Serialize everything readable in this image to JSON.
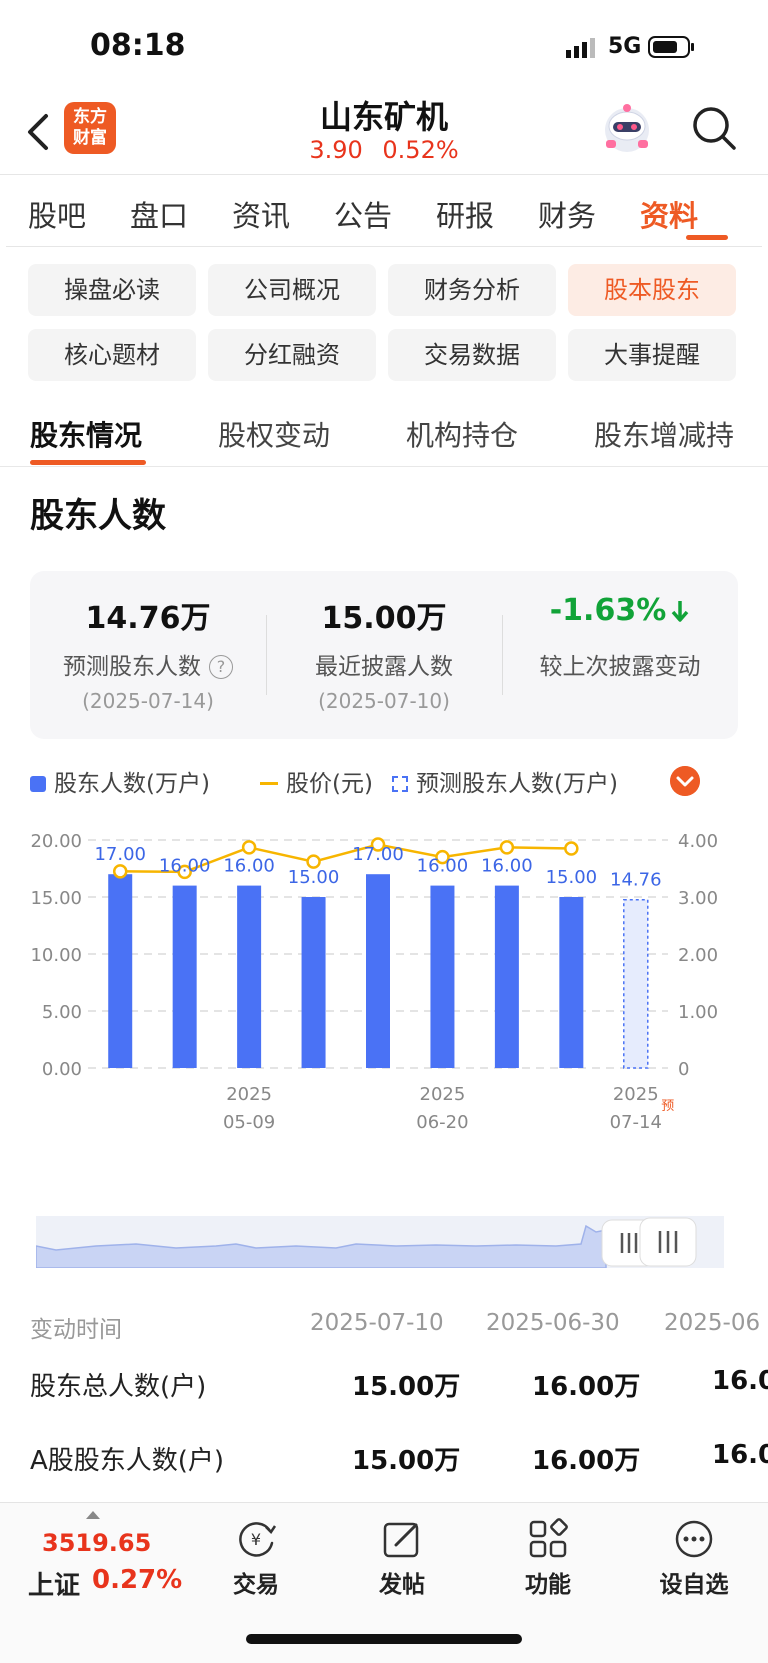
{
  "status_bar": {
    "time": "08:18",
    "network": "5G"
  },
  "header": {
    "logo_line1": "东方",
    "logo_line2": "财富",
    "stock_name": "山东矿机",
    "price": "3.90",
    "change_pct": "0.52%"
  },
  "main_tabs": [
    "股吧",
    "盘口",
    "资讯",
    "公告",
    "研报",
    "财务",
    "资料"
  ],
  "main_tab_active": "资料",
  "chips": [
    "操盘必读",
    "公司概况",
    "财务分析",
    "股本股东",
    "核心题材",
    "分红融资",
    "交易数据",
    "大事提醒"
  ],
  "chip_active": "股本股东",
  "sub_tabs": [
    "股东情况",
    "股权变动",
    "机构持仓",
    "股东增减持"
  ],
  "section_title": "股东人数",
  "stats": [
    {
      "value": "14.76万",
      "label": "预测股东人数",
      "date": "(2025-07-14)"
    },
    {
      "value": "15.00万",
      "label": "最近披露人数",
      "date": "(2025-07-10)"
    },
    {
      "value": "-1.63%",
      "label": "较上次披露变动"
    }
  ],
  "help_mark": "?",
  "legend": {
    "bars": "股东人数(万户)",
    "price": "股价(元)",
    "forecast": "预测股东人数(万户)"
  },
  "chart_data": {
    "type": "bar",
    "series": [
      {
        "name": "股东人数(万户)",
        "values": [
          17.0,
          16.0,
          16.0,
          15.0,
          17.0,
          16.0,
          16.0,
          15.0
        ]
      },
      {
        "name": "预测股东人数(万户)",
        "values": [
          null,
          null,
          null,
          null,
          null,
          null,
          null,
          null,
          14.76
        ]
      },
      {
        "name": "股价(元)",
        "type": "line",
        "values": [
          3.45,
          3.44,
          3.87,
          3.62,
          3.92,
          3.7,
          3.87,
          3.85
        ]
      }
    ],
    "bar_labels": [
      "17.00",
      "16.00",
      "16.00",
      "15.00",
      "17.00",
      "16.00",
      "16.00",
      "15.00",
      "14.76"
    ],
    "x_tick_labels": [
      {
        "index": 2,
        "year": "2025",
        "date": "05-09"
      },
      {
        "index": 5,
        "year": "2025",
        "date": "06-20"
      },
      {
        "index": 8,
        "year": "2025",
        "date": "07-14"
      }
    ],
    "forecast_tag": "预",
    "y_left_ticks": [
      "20.00",
      "15.00",
      "10.00",
      "5.00",
      "0.00"
    ],
    "y_right_ticks": [
      "4.00",
      "3.00",
      "2.00",
      "1.00",
      "0"
    ],
    "ylim_left": [
      0,
      20
    ],
    "ylim_right": [
      0,
      4
    ],
    "grid": true,
    "legend_position": "top-left",
    "colors": {
      "bar": "#4a72f5",
      "line": "#f7b500",
      "forecast": "#4a72f5"
    }
  },
  "table": {
    "header_label": "变动时间",
    "columns": [
      "2025-07-10",
      "2025-06-30",
      "2025-06"
    ],
    "rows": [
      {
        "label": "股东总人数(户)",
        "values": [
          "15.00万",
          "16.00万",
          "16.0"
        ]
      },
      {
        "label": "A股股东人数(户)",
        "values": [
          "15.00万",
          "16.00万",
          "16.0"
        ]
      }
    ]
  },
  "bottom_bar": {
    "index_value": "3519.65",
    "index_name": "上证",
    "index_pct": "0.27%",
    "nav": [
      "交易",
      "发帖",
      "功能",
      "设自选"
    ]
  },
  "colors": {
    "accent": "#ee5a24",
    "up": "#e8341c",
    "down": "#11a338",
    "bar": "#4a72f5"
  }
}
